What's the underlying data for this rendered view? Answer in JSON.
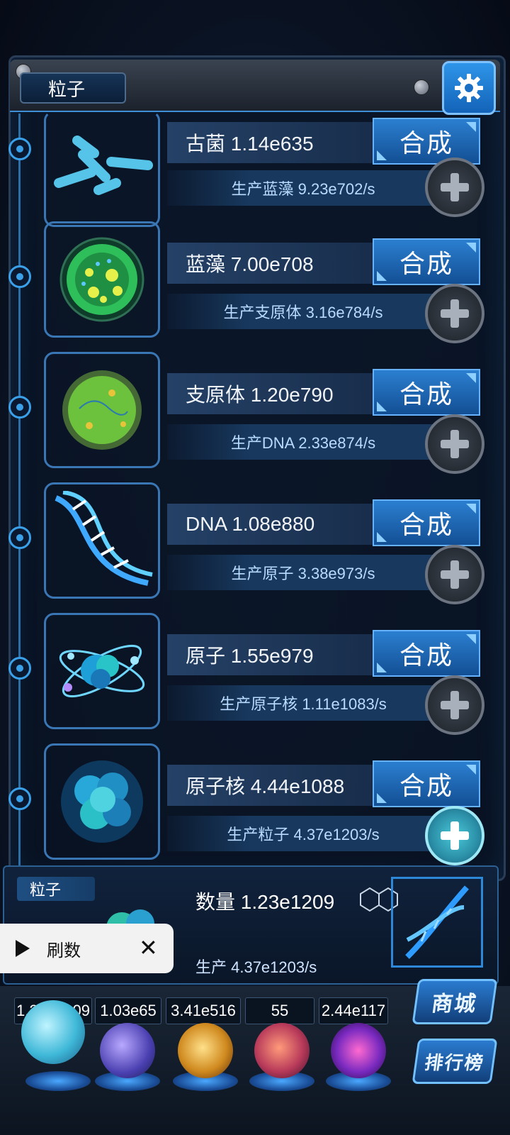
{
  "header": {
    "title": "粒子"
  },
  "colors": {
    "accent": "#2d88d8",
    "button": "#2b7fd0",
    "panel": "#10223c"
  },
  "particles": [
    {
      "name_value": "古菌 1.14e635",
      "synth_label": "合成",
      "production": "生产蓝藻 9.23e702/s",
      "icon": "archaea-icon"
    },
    {
      "name_value": "蓝藻 7.00e708",
      "synth_label": "合成",
      "production": "生产支原体 3.16e784/s",
      "icon": "cyanobacteria-icon"
    },
    {
      "name_value": "支原体 1.20e790",
      "synth_label": "合成",
      "production": "生产DNA 2.33e874/s",
      "icon": "mycoplasma-icon"
    },
    {
      "name_value": "DNA 1.08e880",
      "synth_label": "合成",
      "production": "生产原子 3.38e973/s",
      "icon": "dna-icon"
    },
    {
      "name_value": "原子 1.55e979",
      "synth_label": "合成",
      "production": "生产原子核 1.11e1083/s",
      "icon": "atom-icon"
    },
    {
      "name_value": "原子核 4.44e1088",
      "synth_label": "合成",
      "production": "生产粒子 4.37e1203/s",
      "icon": "nucleus-icon"
    }
  ],
  "bottom": {
    "label": "粒子",
    "count": "数量 1.23e1209",
    "production": "生产 4.37e1203/s"
  },
  "ad": {
    "label": "刷数"
  },
  "resources": [
    {
      "value": "1.23e1209",
      "icon": "particle-orb-icon"
    },
    {
      "value": "1.03e65",
      "icon": "lightning-orb-icon"
    },
    {
      "value": "3.41e516",
      "icon": "galaxy-orb-icon"
    },
    {
      "value": "55",
      "icon": "brain-orb-icon"
    },
    {
      "value": "2.44e117",
      "icon": "vortex-orb-icon"
    }
  ],
  "side_buttons": {
    "shop": "商城",
    "ranking": "排行榜"
  }
}
